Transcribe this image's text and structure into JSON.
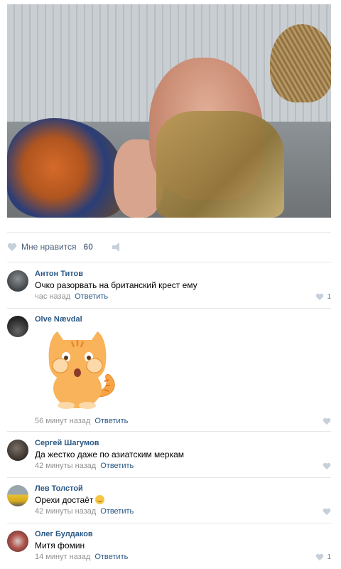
{
  "post": {
    "likes_label": "Мне нравится",
    "likes_count": "60"
  },
  "colors": {
    "link": "#2a5885",
    "meta": "#939393",
    "divider": "#e4e7ea",
    "like_icon": "#c5d0db"
  },
  "comments": [
    {
      "author": "Антон Титов",
      "text": "Очко разорвать на британский крест ему",
      "time": "час назад",
      "reply": "Ответить",
      "likes": "1",
      "avatar_icon": "user-avatar-icon"
    },
    {
      "author": "Olve Nævdal",
      "text": "",
      "sticker": "cat-sticker-icon",
      "time": "56 минут назад",
      "reply": "Ответить",
      "likes": "",
      "avatar_icon": "user-avatar-icon"
    },
    {
      "author": "Сергей Шагумов",
      "text": "Да жестко даже по азиатским меркам",
      "time": "42 минуты назад",
      "reply": "Ответить",
      "likes": "",
      "avatar_icon": "user-avatar-icon"
    },
    {
      "author": "Лев Толстой",
      "text": "Орехи достаёт",
      "emoji": "smile-emoji-icon",
      "time": "42 минуты назад",
      "reply": "Ответить",
      "likes": "",
      "avatar_icon": "user-avatar-icon"
    },
    {
      "author": "Олег Булдаков",
      "text": "Митя фомин",
      "time": "14 минут назад",
      "reply": "Ответить",
      "likes": "1",
      "avatar_icon": "user-avatar-icon"
    }
  ]
}
